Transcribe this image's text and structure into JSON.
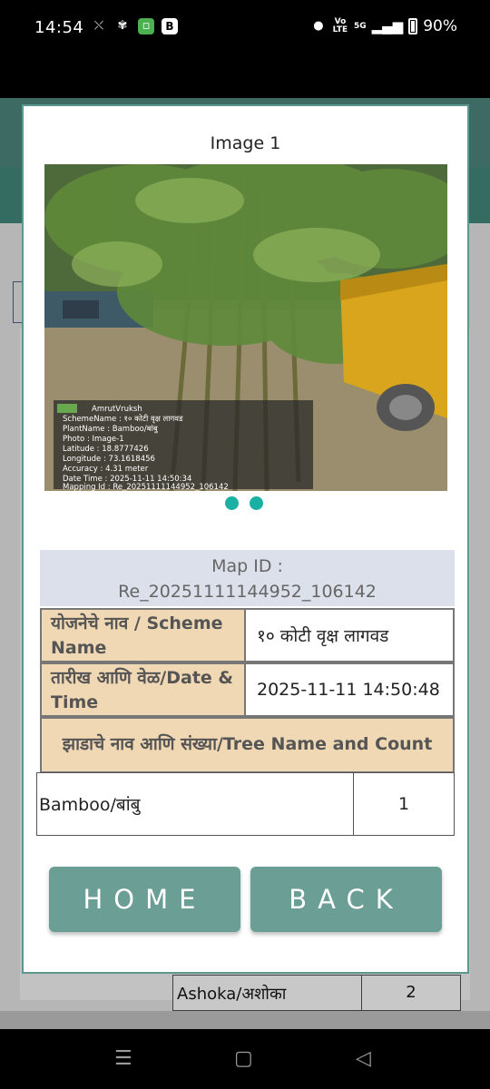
{
  "status_bar": {
    "time": "14:54",
    "network_label": "5G",
    "volte_label": "Vo LTE",
    "battery": "90%",
    "icons": [
      "missed-call-icon",
      "pinwheel-icon",
      "chat-icon",
      "b-icon",
      "location-icon",
      "signal-icon",
      "battery-icon"
    ]
  },
  "background": {
    "table_row": {
      "name": "Ashoka/अशोका",
      "count": "2"
    }
  },
  "dialog": {
    "title": "Image 1",
    "photo_overlay": {
      "app_name": "AmrutVruksh",
      "scheme": "SchemeName : १० कोटी वृक्ष लागवड",
      "plant": "PlantName : Bamboo/बांबु",
      "photo": "Photo : Image-1",
      "latitude": "Latitude : 18.8777426",
      "longitude": "Longitude : 73.1618456",
      "accuracy": "Accuracy : 4.31 meter",
      "datetime": "Date Time : 2025-11-11 14:50:34",
      "mapping": "Mapping Id : Re_20251111144952_106142"
    },
    "map_id_label": "Map ID :",
    "map_id_value": "Re_20251111144952_106142",
    "rows": [
      {
        "label": "योजनेचे नाव / Scheme Name",
        "value": "१० कोटी वृक्ष लागवड"
      },
      {
        "label": "तारीख आणि वेळ/Date & Time",
        "value": "2025-11-11 14:50:48"
      }
    ],
    "tree_header": "झाडाचे नाव आणि संख्या/Tree Name and Count",
    "trees": [
      {
        "name": "Bamboo/बांबु",
        "count": "1"
      }
    ],
    "home_label": "HOME",
    "back_label": "BACK",
    "accent_color": "#6b9f96",
    "dot_color": "#1ab1a4"
  }
}
